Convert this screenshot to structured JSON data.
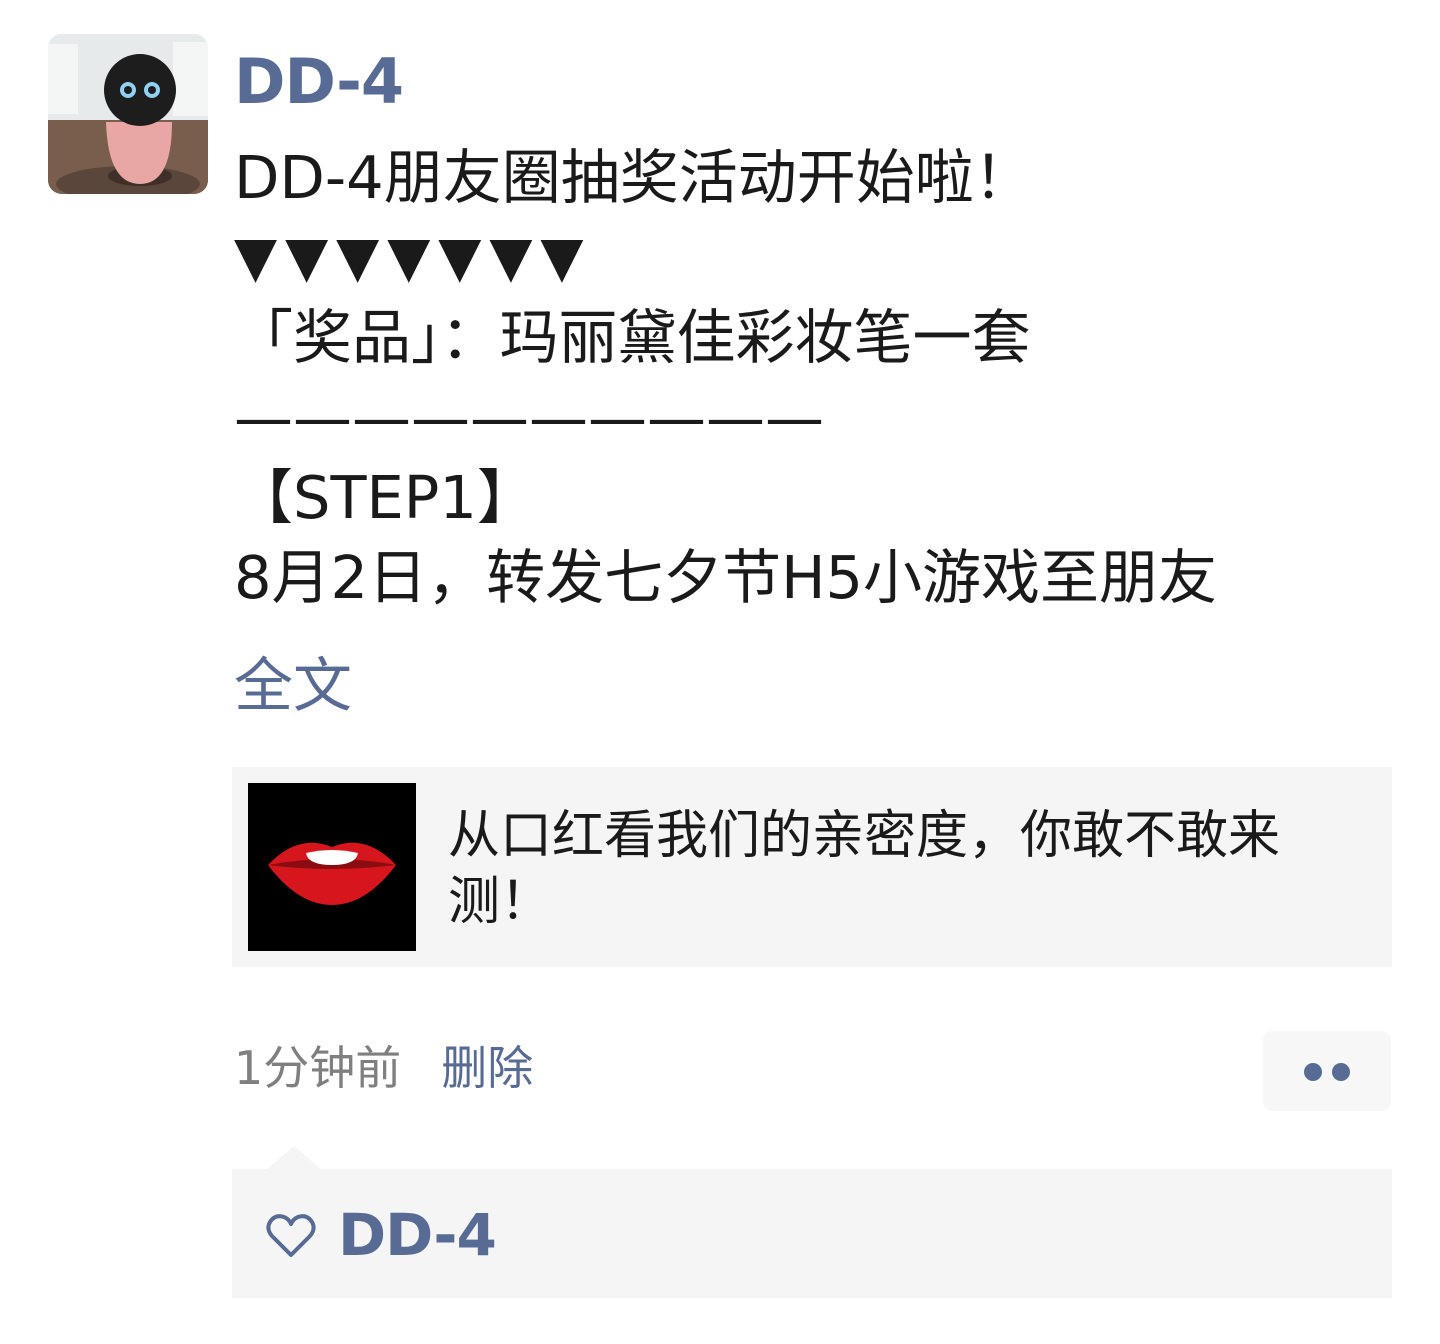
{
  "post": {
    "author": "DD-4",
    "avatar_icon": "robot-avatar-icon",
    "text_lines": [
      "DD-4朋友圈抽奖活动开始啦！",
      "▼▼▼▼▼▼▼",
      "「奖品」：玛丽黛佳彩妆笔一套",
      "——————————",
      "【STEP1】",
      "8月2日，转发七夕节H5小游戏至朋友"
    ],
    "expand_label": "全文"
  },
  "share_card": {
    "thumbnail_icon": "lips-icon",
    "title": "从口红看我们的亲密度，你敢不敢来测！"
  },
  "meta": {
    "time": "1分钟前",
    "delete_label": "删除",
    "more_icon": "more-dots-icon"
  },
  "likes": {
    "icon": "heart-icon",
    "names": "DD-4"
  },
  "colors": {
    "link": "#576b95",
    "panel_bg": "#f5f5f5",
    "text": "#1a1a1a",
    "muted": "#7f7f7f"
  }
}
